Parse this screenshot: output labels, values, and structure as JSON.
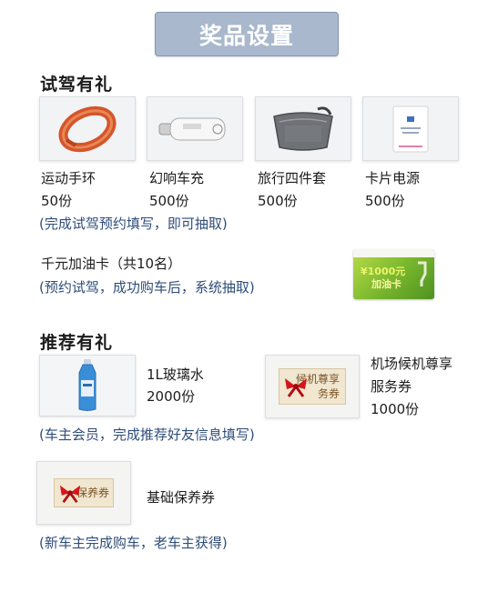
{
  "banner": {
    "title": "奖品设置"
  },
  "test_drive": {
    "title": "试驾有礼",
    "prizes": [
      {
        "name": "运动手环",
        "qty": "50份",
        "icon": "fitness-band-icon"
      },
      {
        "name": "幻响车充",
        "qty": "500份",
        "icon": "car-charger-icon"
      },
      {
        "name": "旅行四件套",
        "qty": "500份",
        "icon": "travel-bag-icon"
      },
      {
        "name": "卡片电源",
        "qty": "500份",
        "icon": "card-power-bank-icon"
      }
    ],
    "note": "(完成试驾预约填写，即可抽取)",
    "gas_card": {
      "title": "千元加油卡（共10名）",
      "note": "(预约试驾，成功购车后，系统抽取)",
      "card_amount": "¥1000元",
      "card_name": "加油卡"
    }
  },
  "referral": {
    "title": "推荐有礼",
    "water": {
      "name": "1L玻璃水",
      "qty": "2000份"
    },
    "airport": {
      "name_line1": "机场候机尊享",
      "name_line2": "服务券",
      "qty": "1000份",
      "voucher_line1": "候机尊享",
      "voucher_line2": "务券"
    },
    "note1": "(车主会员，完成推荐好友信息填写)",
    "maintenance": {
      "name": "基础保养券",
      "voucher_text": "保养券"
    },
    "note2": "(新车主完成购车，老车主获得)"
  },
  "colors": {
    "banner_bg": "#a9b8cc",
    "note_text": "#2f4d7a",
    "voucher_bg": "#f1e6cf",
    "bow_red": "#d4161b"
  }
}
